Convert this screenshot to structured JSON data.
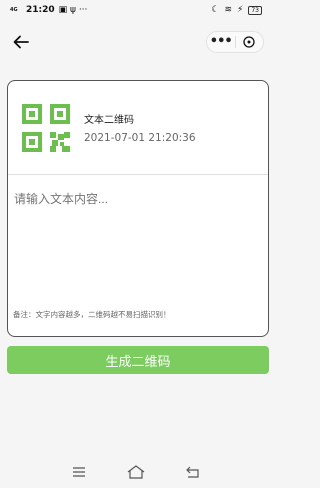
{
  "status_bar": {
    "signal_text": "4G",
    "time": "21:20",
    "battery": "73"
  },
  "card": {
    "title": "文本二维码",
    "date": "2021-07-01 21:20:36",
    "input_placeholder": "请输入文本内容...",
    "note": "备注：文字内容越多，二维码越不易扫描识别！"
  },
  "generate_button": {
    "label": "生成二维码"
  },
  "colors": {
    "accent": "#7dcc60",
    "qr": "#6cbf4e"
  },
  "icons": [
    "back-arrow-icon",
    "more-icon",
    "close-icon",
    "qr-code-icon",
    "menu-icon",
    "home-icon",
    "return-icon"
  ]
}
